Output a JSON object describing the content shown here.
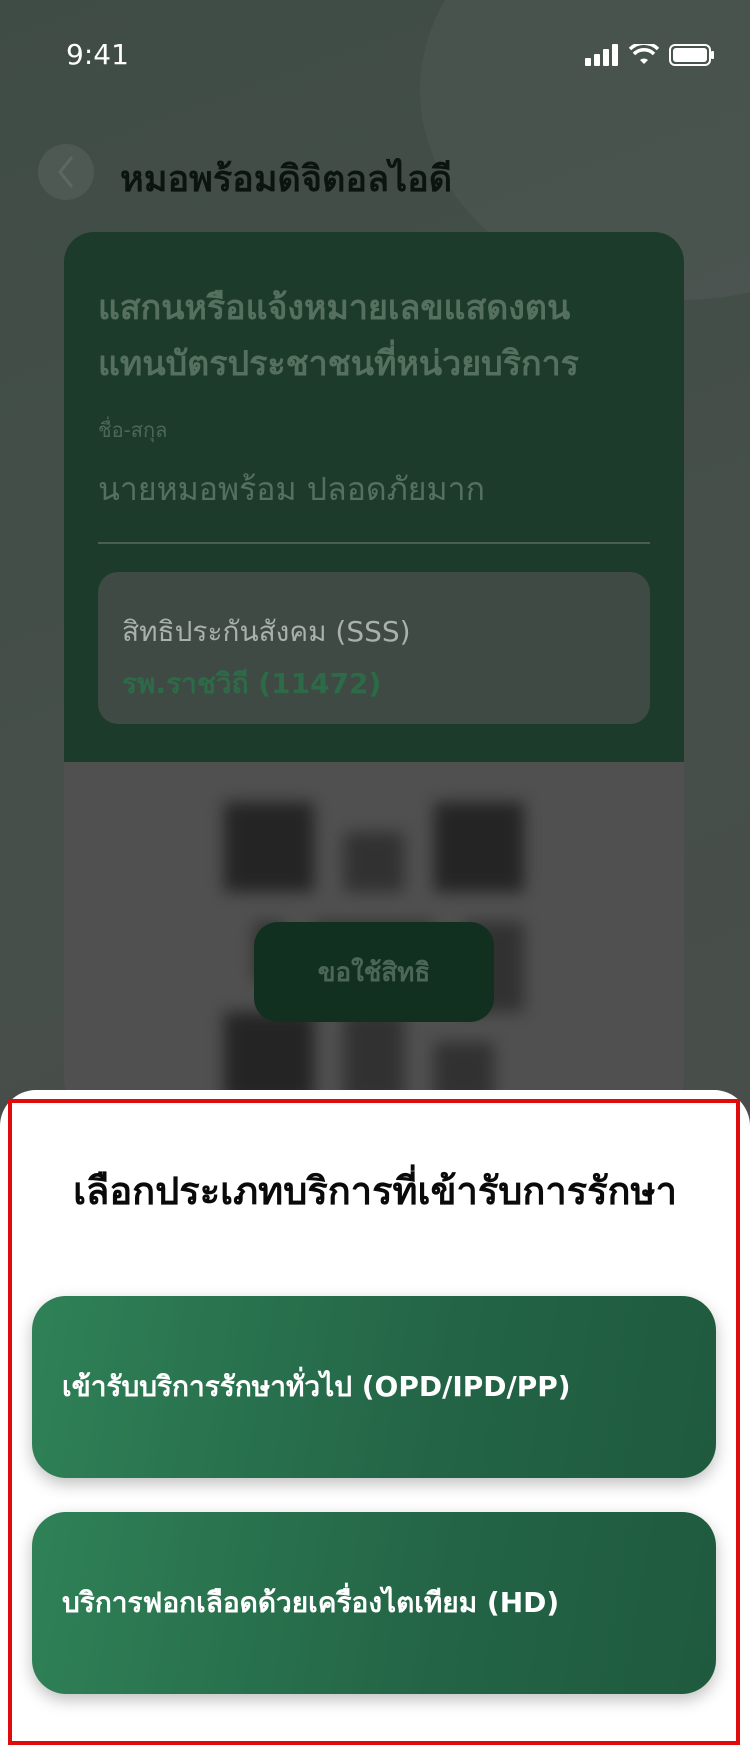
{
  "status_bar": {
    "time": "9:41"
  },
  "nav": {
    "title": "หมอพร้อมดิจิตอลไอดี"
  },
  "card": {
    "heading_line1": "แสกนหรือแจ้งหมายเลขแสดงตน",
    "heading_line2": "แทนบัตรประชาชนที่หน่วยบริการ",
    "name_label": "ชื่อ-สกุล",
    "name_value": "นายหมอพร้อม ปลอดภัยมาก",
    "rights_type": "สิทธิประกันสังคม (SSS)",
    "rights_hospital": "รพ.ราชวิถี (11472)",
    "request_button": "ขอใช้สิทธิ"
  },
  "sheet": {
    "title": "เลือกประเภทบริการที่เข้ารับการรักษา",
    "options": [
      {
        "label": "เข้ารับบริการรักษาทั่วไป (OPD/IPD/PP)"
      },
      {
        "label": "บริการฟอกเลือดด้วยเครื่องไตเทียม (HD)"
      }
    ]
  },
  "colors": {
    "accent": "#2f8157",
    "highlight": "#e00b0b"
  }
}
